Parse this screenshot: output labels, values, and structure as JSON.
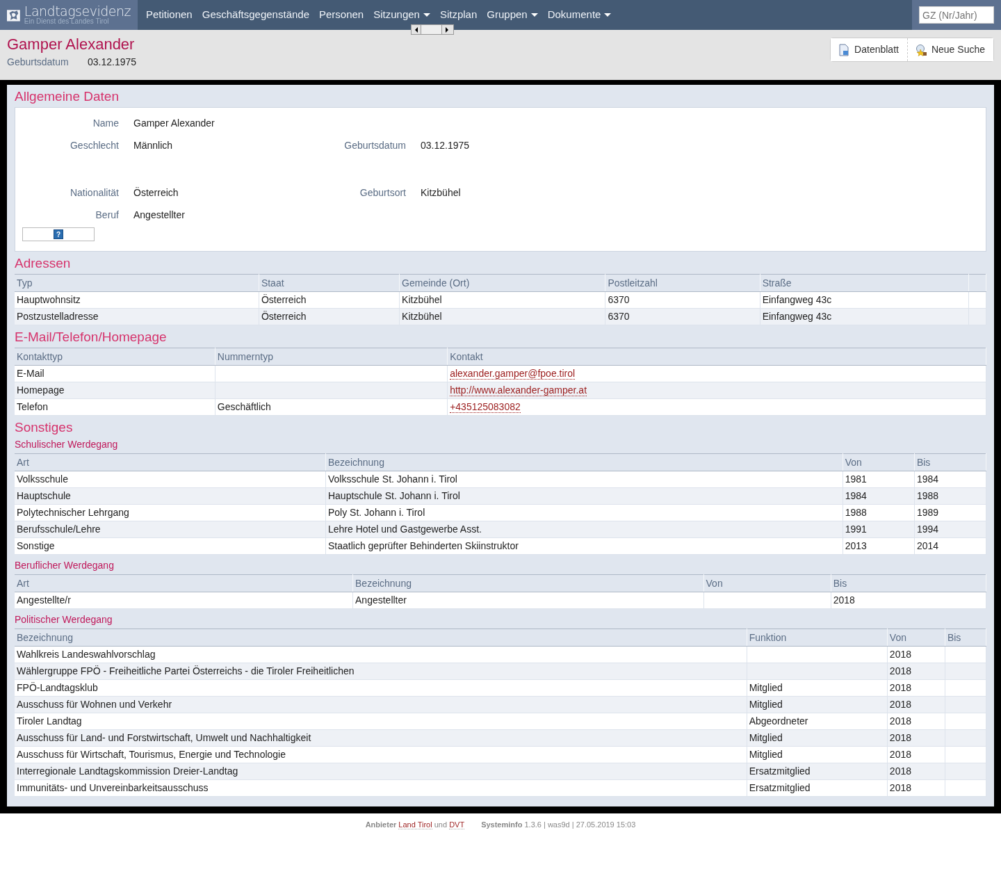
{
  "navbar": {
    "brand": {
      "title": "Landtagsevidenz",
      "subtitle": "Ein Dienst des Landes Tirol"
    },
    "items": [
      {
        "label": "Petitionen",
        "dropdown": false
      },
      {
        "label": "Geschäftsgegenstände",
        "dropdown": false
      },
      {
        "label": "Personen",
        "dropdown": false
      },
      {
        "label": "Sitzungen",
        "dropdown": true
      },
      {
        "label": "Sitzplan",
        "dropdown": false
      },
      {
        "label": "Gruppen",
        "dropdown": true
      },
      {
        "label": "Dokumente",
        "dropdown": true
      }
    ],
    "search": {
      "placeholder": "GZ (Nr/Jahr)"
    }
  },
  "header": {
    "title": "Gamper Alexander",
    "fields": [
      {
        "label": "Geburtsdatum",
        "value": "03.12.1975"
      }
    ],
    "buttons": [
      {
        "label": "Datenblatt",
        "kind": "sheet"
      },
      {
        "label": "Neue Suche",
        "kind": "search"
      }
    ]
  },
  "general": {
    "title": "Allgemeine Daten",
    "rows": [
      [
        {
          "label": "Name",
          "value": "Gamper Alexander"
        }
      ],
      [
        {
          "label": "Geschlecht",
          "value": "Männlich"
        },
        {
          "label": "Geburtsdatum",
          "value": "03.12.1975"
        }
      ],
      [],
      [
        {
          "label": "Nationalität",
          "value": "Österreich"
        },
        {
          "label": "Geburtsort",
          "value": "Kitzbühel"
        }
      ],
      [
        {
          "label": "Beruf",
          "value": "Angestellter"
        }
      ]
    ],
    "help_button": "?"
  },
  "sections": [
    {
      "title": "Adressen",
      "tables": [
        {
          "columns": [
            "Typ",
            "Staat",
            "Gemeinde (Ort)",
            "Postleitzahl",
            "Straße",
            ""
          ],
          "rows": [
            [
              "Hauptwohnsitz",
              "Österreich",
              "Kitzbühel",
              "6370",
              "Einfangweg 43c",
              ""
            ],
            [
              "Postzustelladresse",
              "Österreich",
              "Kitzbühel",
              "6370",
              "Einfangweg 43c",
              ""
            ]
          ]
        }
      ]
    },
    {
      "title": "E-Mail/Telefon/Homepage",
      "tables": [
        {
          "columns": [
            {
              "label": "Kontakttyp",
              "kind": "text"
            },
            {
              "label": "Nummerntyp",
              "kind": "text"
            },
            {
              "label": "Kontakt",
              "kind": "link"
            }
          ],
          "rows": [
            [
              "E-Mail",
              "",
              "alexander.gamper@fpoe.tirol"
            ],
            [
              "Homepage",
              "",
              "http://www.alexander-gamper.at"
            ],
            [
              "Telefon",
              "Geschäftlich",
              "+435125083082"
            ]
          ]
        }
      ]
    },
    {
      "title": "Sonstiges",
      "tables": [
        {
          "subtitle": "Schulischer Werdegang",
          "columns": [
            "Art",
            "Bezeichnung",
            "Von",
            "Bis"
          ],
          "rows": [
            [
              "Volksschule",
              "Volksschule St. Johann i. Tirol",
              "1981",
              "1984"
            ],
            [
              "Hauptschule",
              "Hauptschule St. Johann i. Tirol",
              "1984",
              "1988"
            ],
            [
              "Polytechnischer Lehrgang",
              "Poly St. Johann i. Tirol",
              "1988",
              "1989"
            ],
            [
              "Berufsschule/Lehre",
              "Lehre Hotel und Gastgewerbe Asst.",
              "1991",
              "1994"
            ],
            [
              "Sonstige",
              "Staatlich geprüfter Behinderten Skiinstruktor",
              "2013",
              "2014"
            ]
          ]
        },
        {
          "subtitle": "Beruflicher Werdegang",
          "columns": [
            "Art",
            "Bezeichnung",
            "Von",
            "Bis"
          ],
          "rows": [
            [
              "Angestellte/r",
              "Angestellter",
              "",
              "2018"
            ]
          ]
        },
        {
          "subtitle": "Politischer Werdegang",
          "columns": [
            "Bezeichnung",
            "Funktion",
            "Von",
            "Bis"
          ],
          "rows": [
            [
              "Wahlkreis Landeswahlvorschlag",
              "",
              "2018",
              ""
            ],
            [
              "Wählergruppe FPÖ - Freiheitliche Partei Österreichs - die Tiroler Freiheitlichen",
              "",
              "2018",
              ""
            ],
            [
              "FPÖ-Landtagsklub",
              "Mitglied",
              "2018",
              ""
            ],
            [
              "Ausschuss für Wohnen und Verkehr",
              "Mitglied",
              "2018",
              ""
            ],
            [
              "Tiroler Landtag",
              "Abgeordneter",
              "2018",
              ""
            ],
            [
              "Ausschuss für Land- und Forstwirtschaft, Umwelt und Nachhaltigkeit",
              "Mitglied",
              "2018",
              ""
            ],
            [
              "Ausschuss für Wirtschaft, Tourismus, Energie und Technologie",
              "Mitglied",
              "2018",
              ""
            ],
            [
              "Interregionale Landtagskommission Dreier-Landtag",
              "Ersatzmitglied",
              "2018",
              ""
            ],
            [
              "Immunitäts- und Unvereinbarkeitsausschuss",
              "Ersatzmitglied",
              "2018",
              ""
            ]
          ]
        }
      ]
    }
  ],
  "footer": {
    "provider_label": "Anbieter",
    "links": [
      "Land Tirol",
      "DVT"
    ],
    "conjunction": "und",
    "sysinfo_label": "Systeminfo",
    "sysinfo": "1.3.6 | was9d | 27.05.2019 15:03"
  }
}
